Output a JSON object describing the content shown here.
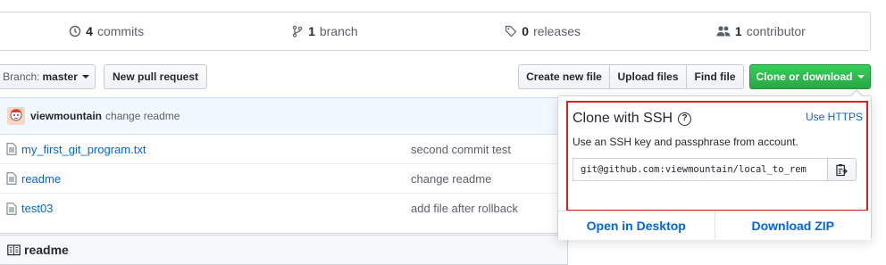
{
  "stats": {
    "commits_count": "4",
    "commits_label": "commits",
    "branch_count": "1",
    "branch_label": "branch",
    "releases_count": "0",
    "releases_label": "releases",
    "contributor_count": "1",
    "contributor_label": "contributor"
  },
  "toolbar": {
    "branch_label": "Branch:",
    "branch_value": "master",
    "new_pr": "New pull request",
    "create_file": "Create new file",
    "upload_files": "Upload files",
    "find_file": "Find file",
    "clone_download": "Clone or download"
  },
  "commit": {
    "author": "viewmountain",
    "message": "change readme"
  },
  "files": [
    {
      "name": "my_first_git_program.txt",
      "message": "second commit test"
    },
    {
      "name": "readme",
      "message": "change readme"
    },
    {
      "name": "test03",
      "message": "add file after rollback"
    }
  ],
  "readme": {
    "title": "readme"
  },
  "clone": {
    "title": "Clone with SSH",
    "use_https": "Use HTTPS",
    "description": "Use an SSH key and passphrase from account.",
    "url": "git@github.com:viewmountain/local_to_rem",
    "open_desktop": "Open in Desktop",
    "download_zip": "Download ZIP"
  },
  "colors": {
    "accent": "#0366d6",
    "green": "#28a745",
    "highlight": "#e02020"
  }
}
